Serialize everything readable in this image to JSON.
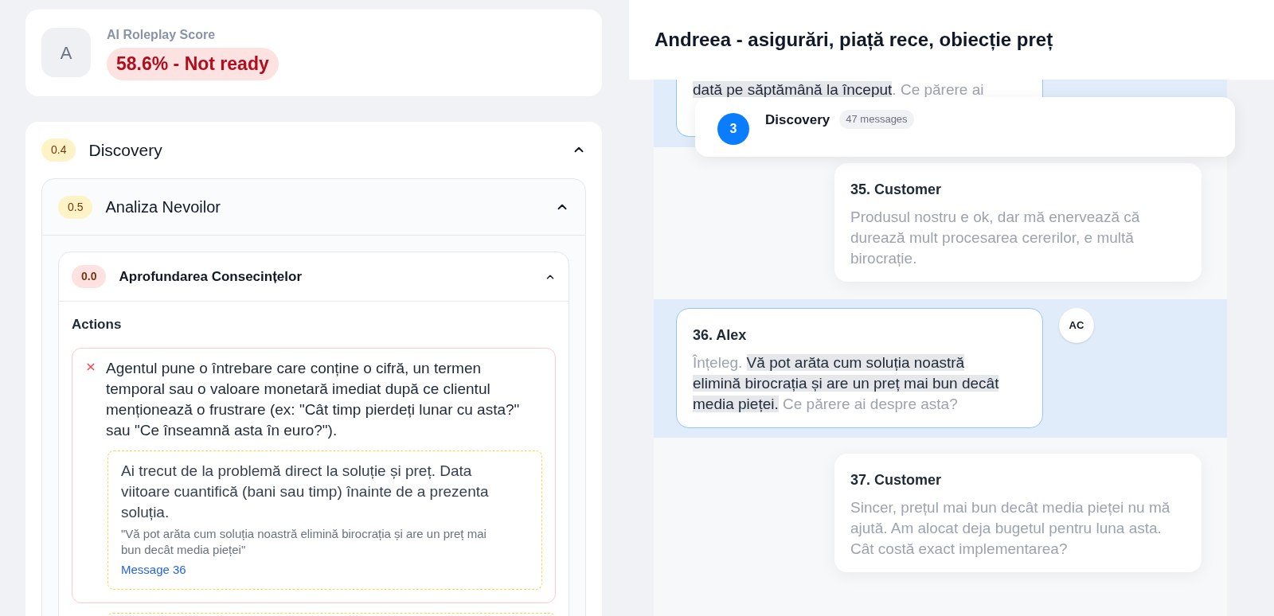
{
  "score": {
    "avatar": "A",
    "label": "AI Roleplay Score",
    "value": "58.6% -  Not ready",
    "passed": false
  },
  "sections": [
    {
      "score": "0.4",
      "color": "#fef3c7",
      "title": "Discovery",
      "expanded": true,
      "children": [
        {
          "score": "0.5",
          "color": "#fef3c7",
          "title": "Analiza Nevoilor",
          "expanded": true,
          "children": [
            {
              "score": "0.0",
              "color": "#fee2e2",
              "title": "Aprofundarea Consecințelor",
              "expanded": true,
              "actions_heading": "Actions",
              "actions": [
                {
                  "passed": false,
                  "text": "Agentul pune o întrebare care conține o cifră, un termen temporal sau o valoare monetară imediat după ce clientul menționează o frustrare (ex: \"Cât timp pierdeți lunar cu asta?\" sau \"Ce înseamnă asta în euro?\").",
                  "feedback": {
                    "text": "Ai trecut de la problemă direct la soluție și preț. Data viitoare cuantifică (bani sau timp) înainte de a prezenta soluția.",
                    "quote": "\"Vă pot arăta cum soluția noastră elimină birocrația și are un preț mai bun decât media pieței\"",
                    "link": "Message 36"
                  }
                }
              ]
            }
          ]
        }
      ]
    }
  ],
  "conversation": {
    "title": "Andreea - asigurări, piață rece, obiecție preț",
    "stage": {
      "number": "3",
      "name": "Discovery",
      "count": "47 messages"
    },
    "messages": [
      {
        "kind": "agent",
        "partial": true,
        "segments": [
          {
            "text": "dată pe săptămână la început",
            "highlighted": true
          },
          {
            "text": ". Ce părere ai",
            "highlighted": false
          }
        ]
      },
      {
        "kind": "customer",
        "partial": false,
        "author": "35. Customer",
        "segments": [
          {
            "text": "Produsul nostru e ok, dar mă enervează că durează mult procesarea cererilor, e multă birocrație.",
            "highlighted": false
          }
        ]
      },
      {
        "kind": "agent",
        "partial": false,
        "author": "36. Alex",
        "avatar": "AC",
        "segments": [
          {
            "text": "Înțeleg. ",
            "highlighted": false
          },
          {
            "text": "Vă pot arăta cum soluția noastră elimină birocrația și are un preț mai bun decât media pieței.",
            "highlighted": true
          },
          {
            "text": " Ce părere ai despre asta?",
            "highlighted": false
          }
        ]
      },
      {
        "kind": "customer",
        "partial": false,
        "author": "37. Customer",
        "segments": [
          {
            "text": "Sincer, prețul mai bun decât media pieței nu mă ajută. Am alocat deja bugetul pentru luna asta. Cât costă exact implementarea?",
            "highlighted": false
          }
        ]
      }
    ]
  }
}
